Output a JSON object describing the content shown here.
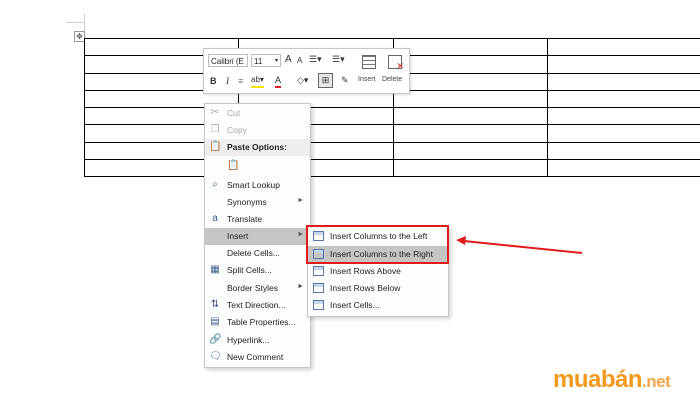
{
  "mini_toolbar": {
    "font_name": "Calibri (E",
    "font_size": "11",
    "grow_font": "A",
    "shrink_font": "A",
    "bold": "B",
    "italic": "I",
    "font_color": "A",
    "insert_label": "Insert",
    "delete_label": "Delete"
  },
  "context_menu": {
    "items": [
      {
        "label": "Cut",
        "icon": "scissors-icon",
        "disabled": true
      },
      {
        "label": "Copy",
        "icon": "copy-icon",
        "disabled": true
      },
      {
        "label": "Paste Options:",
        "icon": "paste-icon",
        "header": true
      },
      {
        "label": "",
        "icon": "paste-keep-text-icon"
      },
      {
        "label": "Smart Lookup",
        "icon": "magnifier-icon"
      },
      {
        "label": "Synonyms",
        "icon": "",
        "submenu": true
      },
      {
        "label": "Translate",
        "icon": "translate-icon"
      },
      {
        "label": "Insert",
        "icon": "",
        "submenu": true,
        "highlighted": true
      },
      {
        "label": "Delete Cells...",
        "icon": ""
      },
      {
        "label": "Split Cells...",
        "icon": "split-cells-icon"
      },
      {
        "label": "Border Styles",
        "icon": "",
        "submenu": true
      },
      {
        "label": "Text Direction...",
        "icon": "text-direction-icon"
      },
      {
        "label": "Table Properties...",
        "icon": "table-properties-icon"
      },
      {
        "label": "Hyperlink...",
        "icon": "hyperlink-icon"
      },
      {
        "label": "New Comment",
        "icon": "comment-icon"
      }
    ]
  },
  "insert_submenu": {
    "items": [
      {
        "label": "Insert Columns to the Left",
        "icon": "insert-column-left-icon"
      },
      {
        "label": "Insert Columns to the Right",
        "icon": "insert-column-right-icon",
        "highlighted": true
      },
      {
        "label": "Insert Rows Above",
        "icon": "insert-row-above-icon"
      },
      {
        "label": "Insert Rows Below",
        "icon": "insert-row-below-icon"
      },
      {
        "label": "Insert Cells...",
        "icon": "insert-cells-icon"
      }
    ]
  },
  "brand": {
    "main": "muabán",
    "suffix": ".net"
  },
  "colors": {
    "highlight": "#c5c5c5",
    "callout": "#e01b1b",
    "brand": "#f39a1e"
  }
}
